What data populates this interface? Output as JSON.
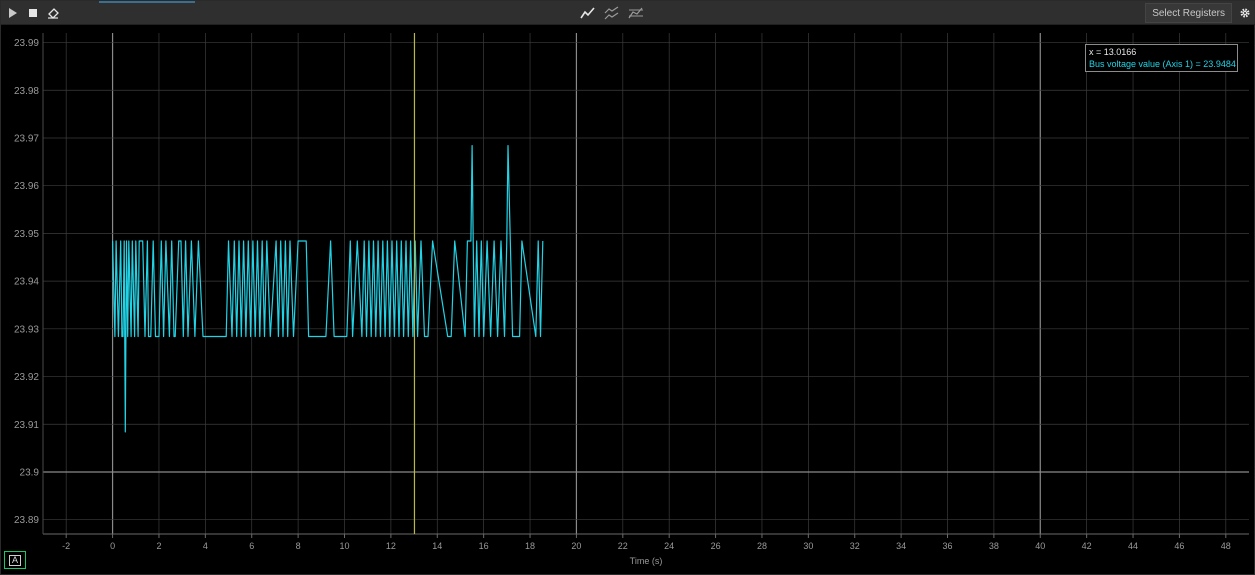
{
  "toolbar": {
    "play_icon": "play-icon",
    "stop_icon": "stop-icon",
    "clear_icon": "eraser-icon",
    "view_icons": [
      "line-view-icon",
      "split-view-icon",
      "overlay-view-icon"
    ],
    "select_registers_label": "Select Registers",
    "settings_icon": "gear-icon"
  },
  "legend": {
    "x_label": "x = 13.0166",
    "series_label": "Bus voltage value (Axis 1) = 23.9484"
  },
  "autoscale": {
    "label": "A"
  },
  "colors": {
    "series": "#22d3e6",
    "cursor": "#b8b84a",
    "grid": "#3c3c3c",
    "grid_major": "#8a8a8a",
    "autoscale_border": "#1ec66a"
  },
  "chart_data": {
    "type": "line",
    "xlabel": "Time (s)",
    "ylabel": "",
    "xlim": [
      -3,
      49
    ],
    "ylim": [
      23.887,
      23.992
    ],
    "xticks": [
      -2,
      0,
      2,
      4,
      6,
      8,
      10,
      12,
      14,
      16,
      18,
      20,
      22,
      24,
      26,
      28,
      30,
      32,
      34,
      36,
      38,
      40,
      42,
      44,
      46,
      48
    ],
    "yticks": [
      23.89,
      23.9,
      23.91,
      23.92,
      23.93,
      23.94,
      23.95,
      23.96,
      23.97,
      23.98,
      23.99
    ],
    "ytick_labels": [
      "23.89",
      "23.9",
      "23.91",
      "23.92",
      "23.93",
      "23.94",
      "23.95",
      "23.96",
      "23.97",
      "23.98",
      "23.99"
    ],
    "major_x_lines": [
      0,
      20,
      40
    ],
    "major_y_lines": [
      23.9
    ],
    "cursor_x": 13.0166,
    "grid": true,
    "series": [
      {
        "name": "Bus voltage value (Axis 1)",
        "x": [
          0.0,
          0.1,
          0.15,
          0.25,
          0.35,
          0.4,
          0.45,
          0.5,
          0.55,
          0.6,
          0.65,
          0.7,
          0.8,
          0.85,
          0.95,
          1.0,
          1.1,
          1.15,
          1.3,
          1.4,
          1.5,
          1.55,
          1.65,
          1.75,
          1.85,
          2.0,
          2.1,
          2.2,
          2.3,
          2.45,
          2.55,
          2.65,
          2.7,
          2.85,
          2.95,
          3.05,
          3.15,
          3.25,
          3.4,
          3.55,
          3.7,
          3.9,
          4.0,
          4.9,
          5.0,
          5.15,
          5.25,
          5.35,
          5.45,
          5.55,
          5.65,
          5.75,
          5.85,
          5.95,
          6.05,
          6.15,
          6.25,
          6.35,
          6.45,
          6.55,
          6.65,
          6.8,
          7.05,
          7.15,
          7.25,
          7.35,
          7.45,
          7.55,
          7.65,
          7.8,
          8.0,
          8.35,
          8.45,
          8.7,
          9.2,
          9.4,
          9.55,
          10.1,
          10.25,
          10.35,
          10.55,
          10.75,
          10.85,
          10.95,
          11.05,
          11.15,
          11.25,
          11.35,
          11.45,
          11.55,
          11.65,
          11.75,
          11.85,
          11.95,
          12.05,
          12.15,
          12.25,
          12.35,
          12.45,
          12.55,
          12.65,
          12.75,
          12.85,
          12.95,
          13.05,
          13.15,
          13.3,
          13.45,
          13.6,
          13.8,
          14.45,
          14.6,
          14.75,
          15.2,
          15.3,
          15.45,
          15.5,
          15.55,
          15.6,
          15.7,
          15.8,
          15.9,
          16.0,
          16.15,
          16.3,
          16.45,
          16.6,
          16.75,
          16.9,
          17.0,
          17.05,
          17.15,
          17.25,
          17.35,
          17.45,
          17.55,
          17.65,
          18.25,
          18.35,
          18.45,
          18.55
        ],
        "y": [
          23.9484,
          23.9284,
          23.9484,
          23.9284,
          23.9484,
          23.9284,
          23.9284,
          23.9484,
          23.9084,
          23.9484,
          23.9284,
          23.9484,
          23.9284,
          23.9484,
          23.9284,
          23.9484,
          23.9284,
          23.9484,
          23.9484,
          23.9284,
          23.9484,
          23.9284,
          23.9284,
          23.9484,
          23.9284,
          23.9284,
          23.9484,
          23.9284,
          23.9484,
          23.9284,
          23.9484,
          23.9284,
          23.9284,
          23.9484,
          23.9484,
          23.9284,
          23.9484,
          23.9284,
          23.9484,
          23.9284,
          23.9484,
          23.9284,
          23.9284,
          23.9284,
          23.9484,
          23.9284,
          23.9484,
          23.9284,
          23.9484,
          23.9284,
          23.9484,
          23.9284,
          23.9484,
          23.9284,
          23.9484,
          23.9284,
          23.9484,
          23.9284,
          23.9484,
          23.9284,
          23.9484,
          23.9284,
          23.9484,
          23.9284,
          23.9484,
          23.9284,
          23.9484,
          23.9284,
          23.9484,
          23.9284,
          23.9484,
          23.9484,
          23.9284,
          23.9284,
          23.9284,
          23.9484,
          23.9284,
          23.9284,
          23.9484,
          23.9284,
          23.9484,
          23.9284,
          23.9484,
          23.9284,
          23.9484,
          23.9284,
          23.9484,
          23.9284,
          23.9484,
          23.9284,
          23.9484,
          23.9284,
          23.9484,
          23.9284,
          23.9484,
          23.9284,
          23.9484,
          23.9284,
          23.9484,
          23.9284,
          23.9484,
          23.9284,
          23.9484,
          23.9284,
          23.9484,
          23.9284,
          23.9484,
          23.9284,
          23.9284,
          23.9484,
          23.9284,
          23.9284,
          23.9484,
          23.9284,
          23.9484,
          23.9484,
          23.9684,
          23.9484,
          23.9284,
          23.9484,
          23.9284,
          23.9484,
          23.9284,
          23.9484,
          23.9284,
          23.9484,
          23.9284,
          23.9484,
          23.9284,
          23.9484,
          23.9684,
          23.9484,
          23.9284,
          23.9284,
          23.9284,
          23.9284,
          23.9484,
          23.9284,
          23.9484,
          23.9284,
          23.9484
        ]
      }
    ]
  }
}
